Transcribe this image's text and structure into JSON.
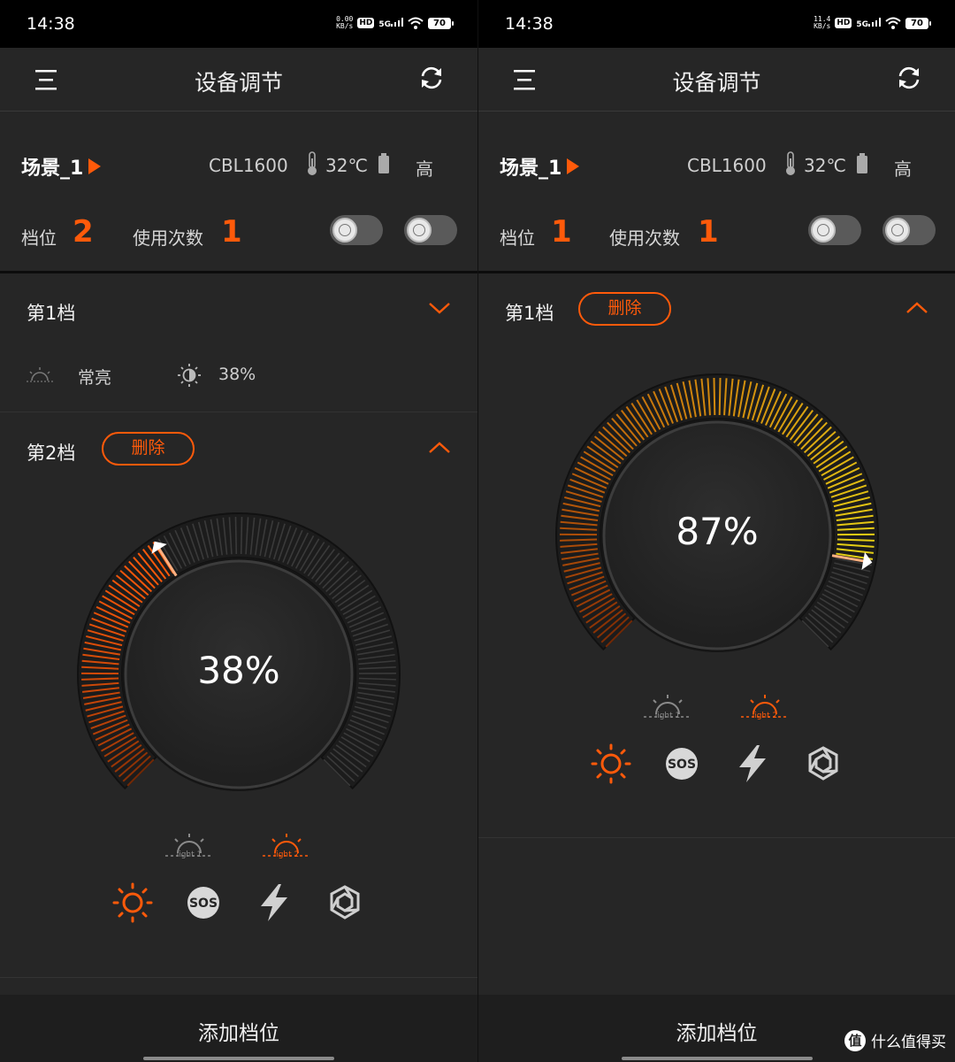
{
  "status_bar": {
    "time": "14:38",
    "left_speed_value": "0.00",
    "right_speed_value": "11.4",
    "speed_unit": "KB/s",
    "hd": "HD",
    "network": "5G",
    "battery": "70"
  },
  "header": {
    "title": "设备调节"
  },
  "device": {
    "scene": "场景_1",
    "model": "CBL1600",
    "temperature": "32℃",
    "power_level": "高",
    "gear_label": "档位",
    "uses_label": "使用次数"
  },
  "screens": {
    "left": {
      "gear_value": "2",
      "uses_value": "1",
      "gear1": {
        "title": "第1档",
        "mode": "常亮",
        "brightness": "38%"
      },
      "gear2": {
        "title": "第2档",
        "delete_label": "删除",
        "dial_value": "38%",
        "dial_fraction": 0.38
      }
    },
    "right": {
      "gear_value": "1",
      "uses_value": "1",
      "gear1": {
        "title": "第1档",
        "delete_label": "删除",
        "dial_value": "87%",
        "dial_fraction": 0.87
      }
    }
  },
  "light_selector": {
    "light1": "light 1",
    "light2": "light 2",
    "selected": "light 2"
  },
  "modes": {
    "sos": "SOS",
    "active": "steady"
  },
  "footer": {
    "add_gear": "添加档位"
  },
  "watermark": {
    "badge": "值",
    "text": "什么值得买"
  },
  "colors": {
    "accent": "#ff5a0a",
    "background": "#262626",
    "text": "#e8e8e8"
  }
}
